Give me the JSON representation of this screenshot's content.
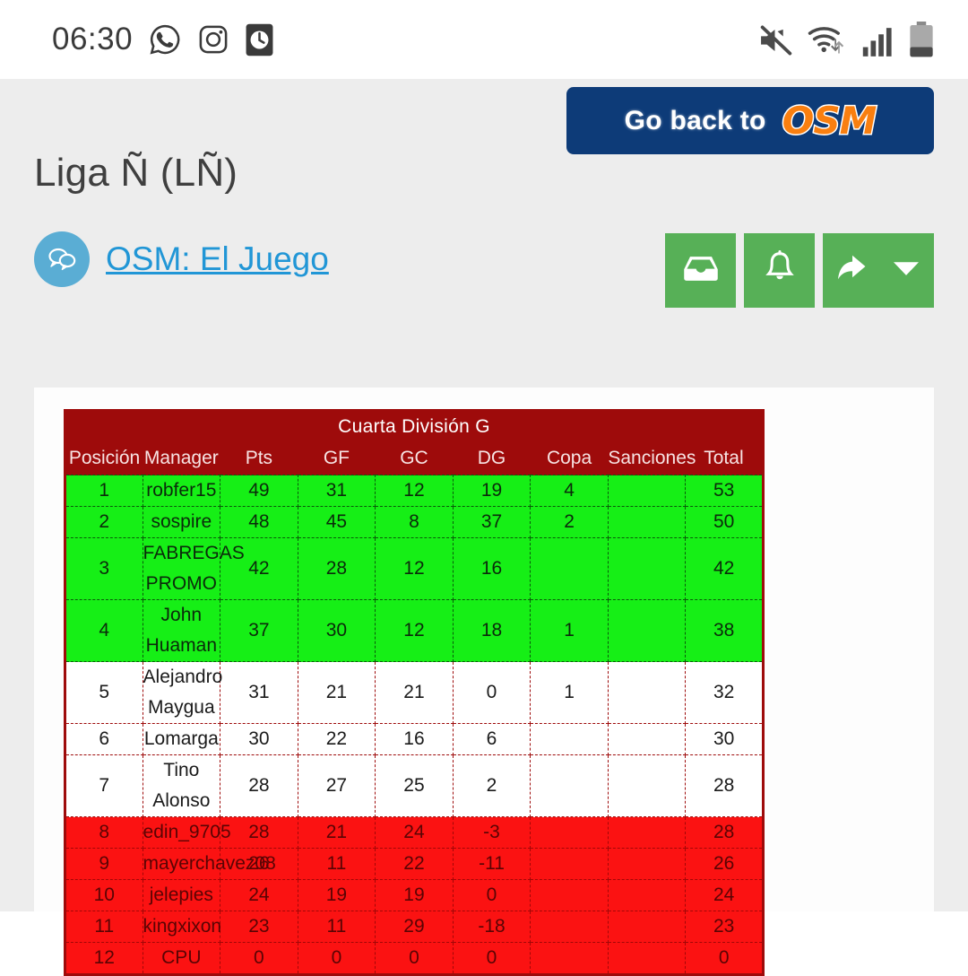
{
  "status_bar": {
    "time": "06:30",
    "left_icons": [
      "whatsapp-icon",
      "instagram-icon",
      "alarm-clock-icon"
    ],
    "right_icons": [
      "mute-icon",
      "wifi-icon",
      "signal-icon",
      "battery-icon"
    ]
  },
  "banner": {
    "text": "Go back to",
    "logo": "OSM"
  },
  "header": {
    "title": "Liga Ñ (LÑ)",
    "link_text": "OSM: El Juego",
    "avatar_icon": "chat-bubbles-icon"
  },
  "action_buttons": [
    {
      "name": "inbox-button",
      "icon": "inbox-icon"
    },
    {
      "name": "notifications-button",
      "icon": "bell-icon"
    },
    {
      "name": "reply-button",
      "icon": "reply-arrow-icon",
      "caret": "chevron-down-icon"
    }
  ],
  "colors": {
    "page_background": "#ededed",
    "card_background": "#fdfdfd",
    "table_header": "#9e0b0b",
    "row_green": "#16ef16",
    "row_white": "#ffffff",
    "row_red": "#fb1212",
    "button_green": "#57b057",
    "banner_navy": "#0d3b78",
    "logo_orange": "#f97f10",
    "link_blue": "#2196d6",
    "avatar_blue": "#5aadd4"
  },
  "table": {
    "title": "Cuarta División G",
    "columns": [
      "Posición",
      "Manager",
      "Pts",
      "GF",
      "GC",
      "DG",
      "Copa",
      "Sanciones",
      "Total"
    ],
    "rows": [
      {
        "zone": "green",
        "pos": "1",
        "manager": "robfer15",
        "pts": "49",
        "gf": "31",
        "gc": "12",
        "dg": "19",
        "copa": "4",
        "sanciones": "",
        "total": "53"
      },
      {
        "zone": "green",
        "pos": "2",
        "manager": "sospire",
        "pts": "48",
        "gf": "45",
        "gc": "8",
        "dg": "37",
        "copa": "2",
        "sanciones": "",
        "total": "50"
      },
      {
        "zone": "green",
        "pos": "3",
        "manager": "FABREGAS PROMO",
        "pts": "42",
        "gf": "28",
        "gc": "12",
        "dg": "16",
        "copa": "",
        "sanciones": "",
        "total": "42"
      },
      {
        "zone": "green",
        "pos": "4",
        "manager": "John Huaman",
        "pts": "37",
        "gf": "30",
        "gc": "12",
        "dg": "18",
        "copa": "1",
        "sanciones": "",
        "total": "38"
      },
      {
        "zone": "white",
        "pos": "5",
        "manager": "Alejandro Maygua",
        "pts": "31",
        "gf": "21",
        "gc": "21",
        "dg": "0",
        "copa": "1",
        "sanciones": "",
        "total": "32"
      },
      {
        "zone": "white",
        "pos": "6",
        "manager": "Lomarga",
        "pts": "30",
        "gf": "22",
        "gc": "16",
        "dg": "6",
        "copa": "",
        "sanciones": "",
        "total": "30"
      },
      {
        "zone": "white",
        "pos": "7",
        "manager": "Tino Alonso",
        "pts": "28",
        "gf": "27",
        "gc": "25",
        "dg": "2",
        "copa": "",
        "sanciones": "",
        "total": "28"
      },
      {
        "zone": "red",
        "pos": "8",
        "manager": "edin_9705",
        "pts": "28",
        "gf": "21",
        "gc": "24",
        "dg": "-3",
        "copa": "",
        "sanciones": "",
        "total": "28"
      },
      {
        "zone": "red",
        "pos": "9",
        "manager": "mayerchavez08",
        "pts": "26",
        "gf": "11",
        "gc": "22",
        "dg": "-11",
        "copa": "",
        "sanciones": "",
        "total": "26"
      },
      {
        "zone": "red",
        "pos": "10",
        "manager": "jelepies",
        "pts": "24",
        "gf": "19",
        "gc": "19",
        "dg": "0",
        "copa": "",
        "sanciones": "",
        "total": "24"
      },
      {
        "zone": "red",
        "pos": "11",
        "manager": "kingxixon",
        "pts": "23",
        "gf": "11",
        "gc": "29",
        "dg": "-18",
        "copa": "",
        "sanciones": "",
        "total": "23"
      },
      {
        "zone": "red",
        "pos": "12",
        "manager": "CPU",
        "pts": "0",
        "gf": "0",
        "gc": "0",
        "dg": "0",
        "copa": "",
        "sanciones": "",
        "total": "0"
      }
    ]
  }
}
